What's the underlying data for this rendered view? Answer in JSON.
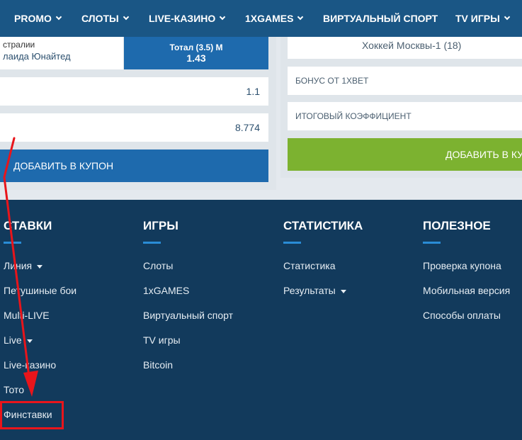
{
  "nav": {
    "items": [
      {
        "label": "PROMO",
        "dropdown": true
      },
      {
        "label": "СЛОТЫ",
        "dropdown": true
      },
      {
        "label": "LIVE-КАЗИНО",
        "dropdown": true
      },
      {
        "label": "1XGAMES",
        "dropdown": true
      },
      {
        "label": "ВИРТУАЛЬНЫЙ СПОРТ",
        "dropdown": false
      },
      {
        "label": "TV ИГРЫ",
        "dropdown": true
      }
    ]
  },
  "coupon_left": {
    "match_line1": "стралии",
    "match_line2": "лаида Юнайтед",
    "bet_type": "Тотал (3.5) М",
    "bet_odds": "1.43",
    "row1_value": "1.1",
    "row2_value": "8.774",
    "add_button": "ДОБАВИТЬ В КУПОН"
  },
  "coupon_right": {
    "event": "Хоккей Москвы-1 (18)",
    "bonus_label": "БОНУС ОТ 1XBET",
    "total_label": "ИТОГОВЫЙ КОЭФФИЦИЕНТ",
    "add_button": "ДОБАВИТЬ В КУ"
  },
  "footer": {
    "columns": [
      {
        "title": "СТАВКИ",
        "links": [
          "Линия",
          "Петушиные бои",
          "Multi-LIVE",
          "Live",
          "Live-казино",
          "Тото",
          "Финставки"
        ]
      },
      {
        "title": "ИГРЫ",
        "links": [
          "Слоты",
          "1xGAMES",
          "Виртуальный спорт",
          "TV игры",
          "Bitcoin"
        ]
      },
      {
        "title": "СТАТИСТИКА",
        "links": [
          "Статистика",
          "Результаты"
        ]
      },
      {
        "title": "ПОЛЕЗНОЕ",
        "links": [
          "Проверка купона",
          "Мобильная версия",
          "Способы оплаты"
        ]
      }
    ]
  },
  "colors": {
    "nav_bg": "#1a5685",
    "footer_bg": "#123a5c",
    "accent_blue": "#1e6aad",
    "accent_green": "#7cb230",
    "highlight_red": "#e8151b"
  }
}
